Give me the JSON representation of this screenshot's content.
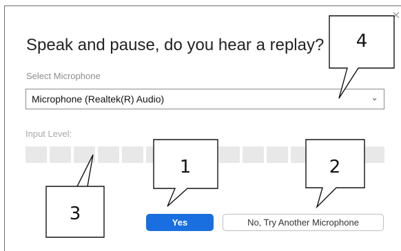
{
  "dialog": {
    "title": "Speak and pause, do you hear a replay?",
    "close_glyph": "×",
    "microphone": {
      "label": "Select Microphone",
      "selected": "Microphone (Realtek(R) Audio)",
      "chevron": "⌄"
    },
    "input_level": {
      "label": "Input Level:",
      "segments": 15,
      "level": 0
    },
    "buttons": {
      "yes": "Yes",
      "no": "No, Try Another Microphone"
    }
  },
  "callouts": [
    {
      "number": "1"
    },
    {
      "number": "2"
    },
    {
      "number": "3"
    },
    {
      "number": "4"
    }
  ],
  "colors": {
    "primary_button": "#1a6fe0",
    "level_segment": "#e8e8e8"
  }
}
